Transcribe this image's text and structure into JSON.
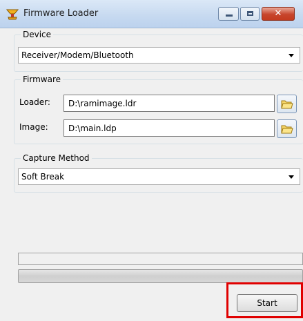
{
  "window": {
    "title": "Firmware Loader"
  },
  "title_buttons": {
    "minimize_icon": "minimize-icon",
    "maximize_icon": "maximize-icon",
    "close_glyph": "✕"
  },
  "device": {
    "label": "Device",
    "selected": "Receiver/Modem/Bluetooth"
  },
  "firmware": {
    "label": "Firmware",
    "loader_label": "Loader:",
    "loader_value": "D:\\ramimage.ldr",
    "image_label": "Image:",
    "image_value": "D:\\main.ldp",
    "browse_icon": "folder-icon"
  },
  "capture": {
    "label": "Capture Method",
    "selected": "Soft Break"
  },
  "progress": {
    "fraction": 0
  },
  "actions": {
    "start_label": "Start"
  },
  "colors": {
    "highlight": "#e00000",
    "titlebar": "#c6d9f0",
    "close": "#c7452c"
  }
}
